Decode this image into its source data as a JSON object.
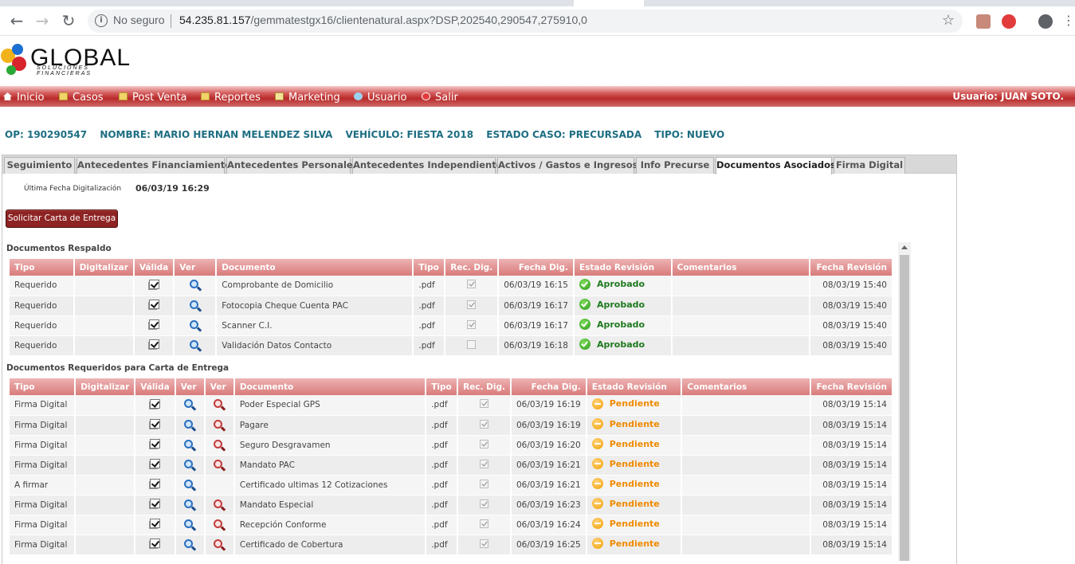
{
  "browser": {
    "security_label": "No seguro",
    "url_host": "54.235.81.157",
    "url_path": "/gemmatestgx16/clientenatural.aspx?DSP,202540,290547,275910,0"
  },
  "logo": {
    "word": "GLOBAL",
    "sub": "SOLUCIONES FINANCIERAS"
  },
  "menu": {
    "items": [
      {
        "label": "Inicio",
        "icon": "home-icon"
      },
      {
        "label": "Casos",
        "icon": "folder-icon"
      },
      {
        "label": "Post Venta",
        "icon": "folder-icon"
      },
      {
        "label": "Reportes",
        "icon": "folder-icon"
      },
      {
        "label": "Marketing",
        "icon": "mail-icon"
      },
      {
        "label": "Usuario",
        "icon": "user-icon"
      },
      {
        "label": "Salir",
        "icon": "exit-icon"
      }
    ],
    "user": "Usuario:  JUAN SOTO."
  },
  "case": {
    "op": "OP: 190290547",
    "nombre": "NOMBRE: MARIO HERNAN MELENDEZ SILVA",
    "vehiculo": "VEHÍCULO: FIESTA 2018",
    "estado": "ESTADO CASO: PRECURSADA",
    "tipo": "TIPO: NUEVO"
  },
  "tabs": [
    "Seguimiento",
    "Antecedentes Financiamiento",
    "Antecedentes Personales",
    "Antecedentes Independiente",
    "Activos / Gastos e Ingresos",
    "Info Precurse",
    "Documentos Asociados",
    "Firma Digital"
  ],
  "active_tab": "Documentos Asociados",
  "ultima": {
    "label": "Última Fecha Digitalización",
    "value": "06/03/19 16:29"
  },
  "button_carta": "Solicitar Carta de Entrega",
  "respaldo": {
    "title": "Documentos Respaldo",
    "headers": [
      "Tipo",
      "Digitalizar",
      "Válida",
      "Ver",
      "Documento",
      "Tipo",
      "Rec. Dig.",
      "Fecha Dig.",
      "Estado Revisión",
      "Comentarios",
      "Fecha Revisión"
    ],
    "rows": [
      {
        "tipo": "Requerido",
        "documento": "Comprobante de Domicilio",
        "ext": ".pdf",
        "rec": true,
        "fecha": "06/03/19 16:15",
        "estado": "Aprobado",
        "fecha_rev": "08/03/19 15:40"
      },
      {
        "tipo": "Requerido",
        "documento": "Fotocopia Cheque Cuenta PAC",
        "ext": ".pdf",
        "rec": true,
        "fecha": "06/03/19 16:17",
        "estado": "Aprobado",
        "fecha_rev": "08/03/19 15:40"
      },
      {
        "tipo": "Requerido",
        "documento": "Scanner C.I.",
        "ext": ".pdf",
        "rec": true,
        "fecha": "06/03/19 16:17",
        "estado": "Aprobado",
        "fecha_rev": "08/03/19 15:40"
      },
      {
        "tipo": "Requerido",
        "documento": "Validación Datos Contacto",
        "ext": ".pdf",
        "rec": false,
        "fecha": "06/03/19 16:18",
        "estado": "Aprobado",
        "fecha_rev": "08/03/19 15:40"
      }
    ]
  },
  "carta": {
    "title": "Documentos Requeridos para Carta de Entrega",
    "headers": [
      "Tipo",
      "Digitalizar",
      "Válida",
      "Ver",
      "Ver",
      "Documento",
      "Tipo",
      "Rec. Dig.",
      "Fecha Dig.",
      "Estado Revisión",
      "Comentarios",
      "Fecha Revisión"
    ],
    "rows": [
      {
        "tipo": "Firma Digital",
        "ver2": true,
        "documento": "Poder Especial GPS",
        "ext": ".pdf",
        "fecha": "06/03/19 16:19",
        "estado": "Pendiente",
        "fecha_rev": "08/03/19 15:14"
      },
      {
        "tipo": "Firma Digital",
        "ver2": true,
        "documento": "Pagare",
        "ext": ".pdf",
        "fecha": "06/03/19 16:19",
        "estado": "Pendiente",
        "fecha_rev": "08/03/19 15:14"
      },
      {
        "tipo": "Firma Digital",
        "ver2": true,
        "documento": "Seguro Desgravamen",
        "ext": ".pdf",
        "fecha": "06/03/19 16:20",
        "estado": "Pendiente",
        "fecha_rev": "08/03/19 15:14"
      },
      {
        "tipo": "Firma Digital",
        "ver2": true,
        "documento": "Mandato PAC",
        "ext": ".pdf",
        "fecha": "06/03/19 16:21",
        "estado": "Pendiente",
        "fecha_rev": "08/03/19 15:14"
      },
      {
        "tipo": "A firmar",
        "ver2": false,
        "documento": "Certificado ultimas 12 Cotizaciones",
        "ext": ".pdf",
        "fecha": "06/03/19 16:21",
        "estado": "Pendiente",
        "fecha_rev": "08/03/19 15:14"
      },
      {
        "tipo": "Firma Digital",
        "ver2": true,
        "documento": "Mandato Especial",
        "ext": ".pdf",
        "fecha": "06/03/19 16:23",
        "estado": "Pendiente",
        "fecha_rev": "08/03/19 15:14"
      },
      {
        "tipo": "Firma Digital",
        "ver2": true,
        "documento": "Recepción Conforme",
        "ext": ".pdf",
        "fecha": "06/03/19 16:24",
        "estado": "Pendiente",
        "fecha_rev": "08/03/19 15:14"
      },
      {
        "tipo": "Firma Digital",
        "ver2": true,
        "documento": "Certificado de Cobertura",
        "ext": ".pdf",
        "fecha": "06/03/19 16:25",
        "estado": "Pendiente",
        "fecha_rev": "08/03/19 15:14"
      }
    ]
  }
}
